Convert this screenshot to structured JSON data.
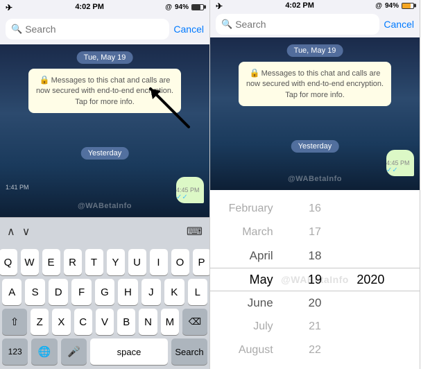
{
  "left_panel": {
    "status_bar": {
      "time": "4:02 PM",
      "battery": "94%",
      "battery_icon": "▓"
    },
    "search": {
      "placeholder": "Search",
      "cancel_label": "Cancel"
    },
    "chat": {
      "date_badge": "Tue, May 19",
      "enc_message": "Messages to this chat and calls are now secured with end-to-end encryption. Tap for more info.",
      "yesterday_label": "Yesterday",
      "time_label": "1:41 PM",
      "out_bubble_time": "4:45 PM",
      "out_bubble_ticks": "✓✓"
    },
    "keyboard_toolbar": {
      "chevron_up": "⌃",
      "chevron_down": "⌄",
      "keyboard_icon": "⌨"
    },
    "keyboard": {
      "rows": [
        [
          "Q",
          "W",
          "E",
          "R",
          "T",
          "Y",
          "U",
          "I",
          "O",
          "P"
        ],
        [
          "A",
          "S",
          "D",
          "F",
          "G",
          "H",
          "J",
          "K",
          "L"
        ],
        [
          "Z",
          "X",
          "C",
          "V",
          "B",
          "N",
          "M"
        ]
      ],
      "space_label": "space",
      "search_label": "Search",
      "numbers_label": "123"
    },
    "watermark": "@WABetaInfo"
  },
  "right_panel": {
    "status_bar": {
      "time": "4:02 PM",
      "battery": "94%"
    },
    "search": {
      "placeholder": "Search",
      "cancel_label": "Cancel"
    },
    "chat": {
      "date_badge": "Tue, May 19",
      "enc_message": "Messages to this chat and calls are now secured with end-to-end encryption. Tap for more info.",
      "yesterday_label": "Yesterday",
      "out_bubble_time": "4:45 PM",
      "out_bubble_ticks": "✓✓"
    },
    "date_picker": {
      "months": [
        "February",
        "March",
        "April",
        "May",
        "June",
        "July",
        "August"
      ],
      "days": [
        "16",
        "17",
        "18",
        "19",
        "20",
        "21",
        "22"
      ],
      "years": [
        "2020"
      ],
      "selected_month": "May",
      "selected_day": "19",
      "selected_year": "2020"
    },
    "watermark": "@WABetaInfo"
  }
}
